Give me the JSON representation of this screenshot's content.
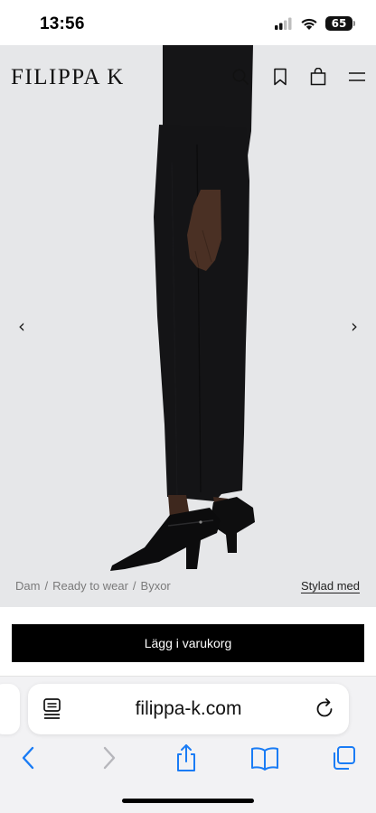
{
  "status_bar": {
    "time": "13:56",
    "battery": "65"
  },
  "header": {
    "logo": "FILIPPA K"
  },
  "gallery": {
    "prev": "‹",
    "next": "›"
  },
  "breadcrumb": {
    "items": [
      "Dam",
      "Ready to wear",
      "Byxor"
    ],
    "separator": "/"
  },
  "styled_with": "Stylad med",
  "add_to_cart": "Lägg i varukorg",
  "browser": {
    "url": "filippa-k.com"
  },
  "colors": {
    "accent": "#000000",
    "background": "#e6e7e9",
    "link_blue": "#1a7cf5"
  }
}
